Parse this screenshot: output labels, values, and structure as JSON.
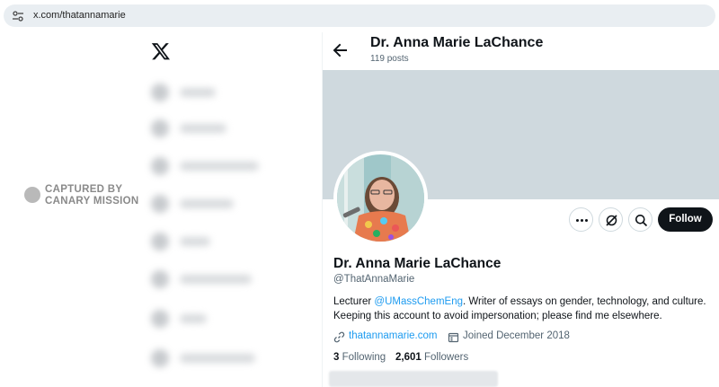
{
  "browser": {
    "url": "x.com/thatannamarie",
    "site_icon": "tune-settings-icon"
  },
  "sidebar": {
    "logo": "x-logo",
    "watermark_line1": "CAPTURED BY",
    "watermark_line2": "CANARY MISSION",
    "watermark_icon": "canary-icon"
  },
  "header": {
    "name": "Dr. Anna Marie LaChance",
    "posts": "119 posts",
    "back_icon": "arrow-left-icon"
  },
  "profile": {
    "display_name": "Dr. Anna Marie LaChance",
    "handle": "@ThatAnnaMarie",
    "bio_before": "Lecturer ",
    "bio_mention": "@UMassChemEng",
    "bio_after": ". Writer of essays on gender, technology, and culture. Keeping this account to avoid impersonation; please find me elsewhere.",
    "website": "thatannamarie.com",
    "joined": "Joined December 2018",
    "following_count": "3",
    "following_label": "Following",
    "followers_count": "2,601",
    "followers_label": "Followers"
  },
  "actions": {
    "more_icon": "more-icon",
    "grok_icon": "grok-icon",
    "search_icon": "search-icon",
    "follow_label": "Follow"
  },
  "colors": {
    "banner": "#cfd9de",
    "link": "#1d9bf0",
    "follow_bg": "#0f1419"
  }
}
